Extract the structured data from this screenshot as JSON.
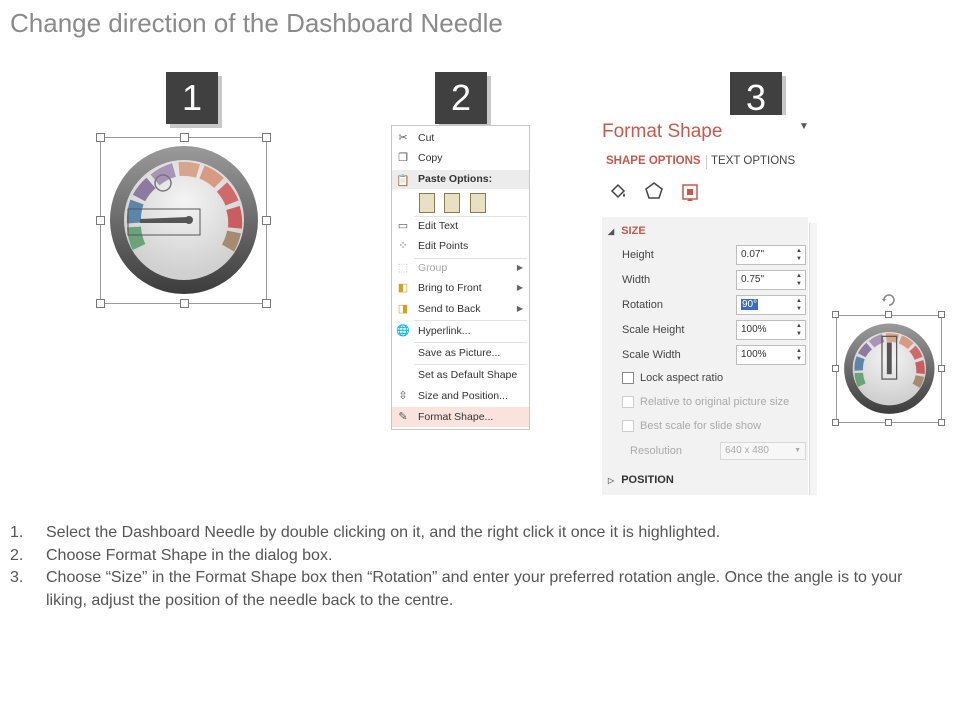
{
  "title": "Change direction of the Dashboard Needle",
  "steps": [
    "1",
    "2",
    "3"
  ],
  "context_menu": {
    "items": [
      {
        "label": "Cut",
        "icon": "scissors-icon"
      },
      {
        "label": "Copy",
        "icon": "copy-icon"
      },
      {
        "label": "Paste Options:",
        "icon": "paste-icon"
      },
      {
        "label": "Edit Text",
        "icon": "edit-text-icon"
      },
      {
        "label": "Edit Points",
        "icon": "edit-points-icon"
      },
      {
        "label": "Group",
        "icon": "group-icon",
        "disabled": true
      },
      {
        "label": "Bring to Front",
        "icon": "bring-front-icon"
      },
      {
        "label": "Send to Back",
        "icon": "send-back-icon"
      },
      {
        "label": "Hyperlink...",
        "icon": "hyperlink-icon"
      },
      {
        "label": "Save as Picture...",
        "icon": ""
      },
      {
        "label": "Set as Default Shape",
        "icon": ""
      },
      {
        "label": "Size and Position...",
        "icon": "size-position-icon"
      },
      {
        "label": "Format Shape...",
        "icon": "format-shape-icon"
      }
    ]
  },
  "format_pane": {
    "title": "Format Shape",
    "tabs": [
      "SHAPE OPTIONS",
      "TEXT OPTIONS"
    ],
    "size_header": "SIZE",
    "rows": [
      {
        "label": "Height",
        "value": "0.07\""
      },
      {
        "label": "Width",
        "value": "0.75\""
      },
      {
        "label": "Rotation",
        "value": "90°"
      },
      {
        "label": "Scale Height",
        "value": "100%"
      },
      {
        "label": "Scale Width",
        "value": "100%"
      }
    ],
    "checkboxes": [
      {
        "label": "Lock aspect ratio",
        "disabled": false
      },
      {
        "label": "Relative to original picture size",
        "disabled": true
      },
      {
        "label": "Best scale for slide show",
        "disabled": true
      }
    ],
    "resolution_label": "Resolution",
    "resolution_value": "640 x 480",
    "position_header": "POSITION"
  },
  "instructions": [
    {
      "num": "1.",
      "text": "Select the Dashboard Needle by double clicking on it, and the right click it once it is highlighted."
    },
    {
      "num": "2.",
      "text": "Choose Format Shape in the dialog box."
    },
    {
      "num": "3.",
      "text": "Choose “Size” in the Format Shape box then “Rotation” and enter your preferred rotation angle. Once the angle is to your liking, adjust the position of the needle back to the centre."
    }
  ],
  "colors": {
    "accent": "#c9584b",
    "badge": "#404040",
    "highlight": "#fbe3dd",
    "selection": "#3a6bc3"
  }
}
